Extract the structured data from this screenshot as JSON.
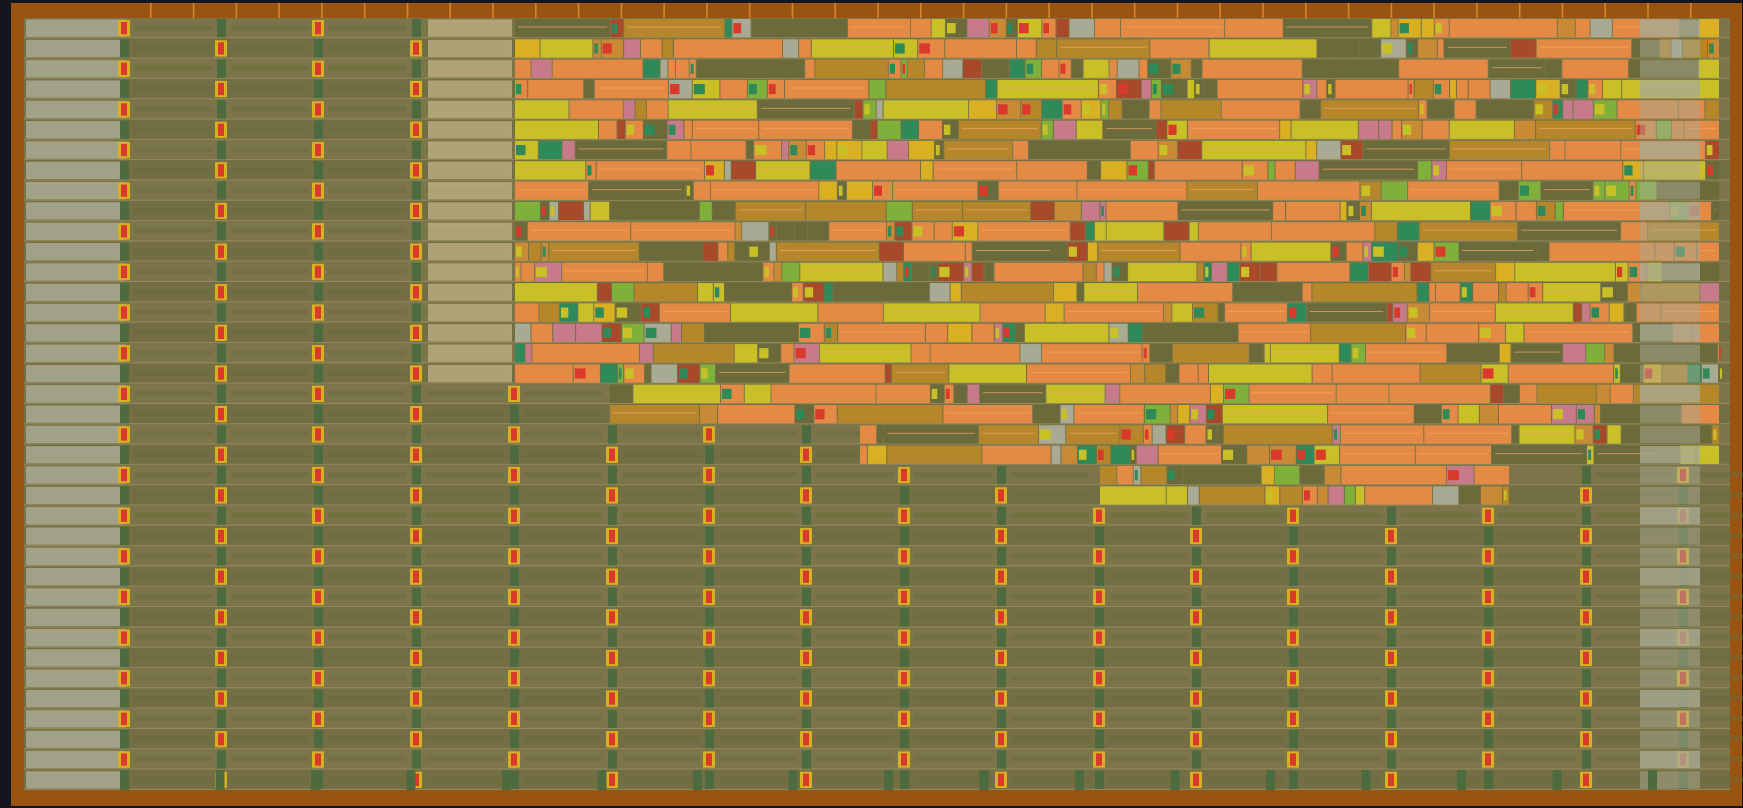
{
  "viewer": {
    "background": "#14151d",
    "die_ring_color": "#9a5412",
    "core_background": "#7c7448"
  },
  "layout": {
    "row_count": 38,
    "row_colors": [
      "#7b7549",
      "#746e44"
    ],
    "strap_color": "#a39a6a",
    "pin_color": "#d2852b",
    "pin_count_top": 37
  },
  "legend": {
    "std_cell": "#6b6a3a",
    "filler": "#a9aa93",
    "fill_cap": "#c8b88a",
    "tap_cell": "#4e6a3f",
    "decap_core": "#d93a2b",
    "decap_body": "#d9b021",
    "flop": "#e58a45",
    "buffer": "#c98a36",
    "nand_cell": "#c77a8a",
    "mux_cell": "#c9c028",
    "inverter": "#2f8a5a",
    "and_or_cell": "#7fb03a",
    "latch": "#b5862a",
    "xor_cell": "#a84a2a"
  }
}
